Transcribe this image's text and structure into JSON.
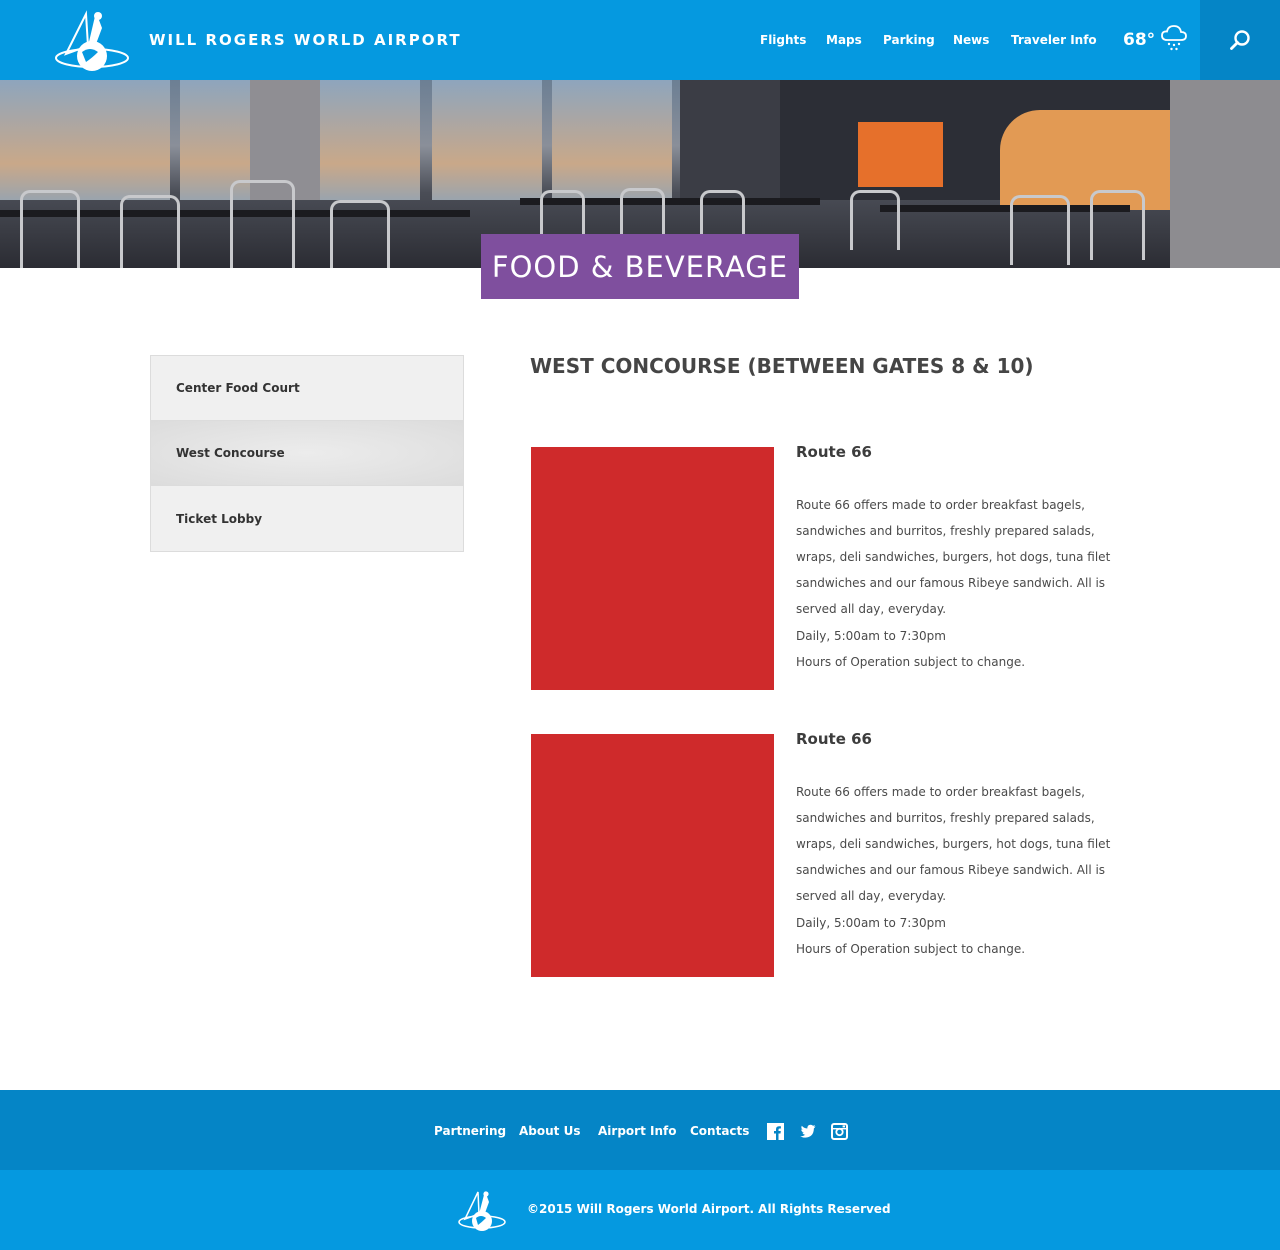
{
  "header": {
    "site_title": "WILL ROGERS WORLD AIRPORT",
    "nav": [
      "Flights",
      "Maps",
      "Parking",
      "News",
      "Traveler Info"
    ],
    "temperature": "68°",
    "weather_icon": "cloud-snow-icon",
    "search_icon": "search-icon"
  },
  "hero": {
    "banner_title": "FOOD & BEVERAGE"
  },
  "sidebar": {
    "items": [
      {
        "label": "Center Food Court",
        "active": false
      },
      {
        "label": "West Concourse",
        "active": true
      },
      {
        "label": "Ticket Lobby",
        "active": false
      }
    ]
  },
  "main": {
    "section_title": "WEST CONCOURSE (BETWEEN GATES 8 & 10)",
    "entries": [
      {
        "name": "Route 66",
        "description": "Route 66 offers made to order breakfast bagels, sandwiches and burritos, freshly prepared salads, wraps, deli sandwiches, burgers, hot dogs, tuna filet sandwiches and our famous Ribeye sandwich.  All is served all day, everyday.",
        "hours": "Daily, 5:00am to 7:30pm",
        "note": "Hours of Operation subject to change."
      },
      {
        "name": "Route 66",
        "description": "Route 66 offers made to order breakfast bagels, sandwiches and burritos, freshly prepared salads, wraps, deli sandwiches, burgers, hot dogs, tuna filet sandwiches and our famous Ribeye sandwich.  All is served all day, everyday.",
        "hours": "Daily, 5:00am to 7:30pm",
        "note": "Hours of Operation subject to change."
      }
    ]
  },
  "footer": {
    "links": [
      "Partnering",
      "About Us",
      "Airport Info",
      "Contacts"
    ],
    "social": [
      "facebook-icon",
      "twitter-icon",
      "instagram-icon"
    ],
    "copyright": "©2015 Will Rogers World Airport. All Rights Reserved"
  },
  "colors": {
    "header_blue": "#0599e0",
    "footer_dark_blue": "#0585c6",
    "banner_purple": "#7f4f9e",
    "image_placeholder_red": "#cf2a2b"
  }
}
